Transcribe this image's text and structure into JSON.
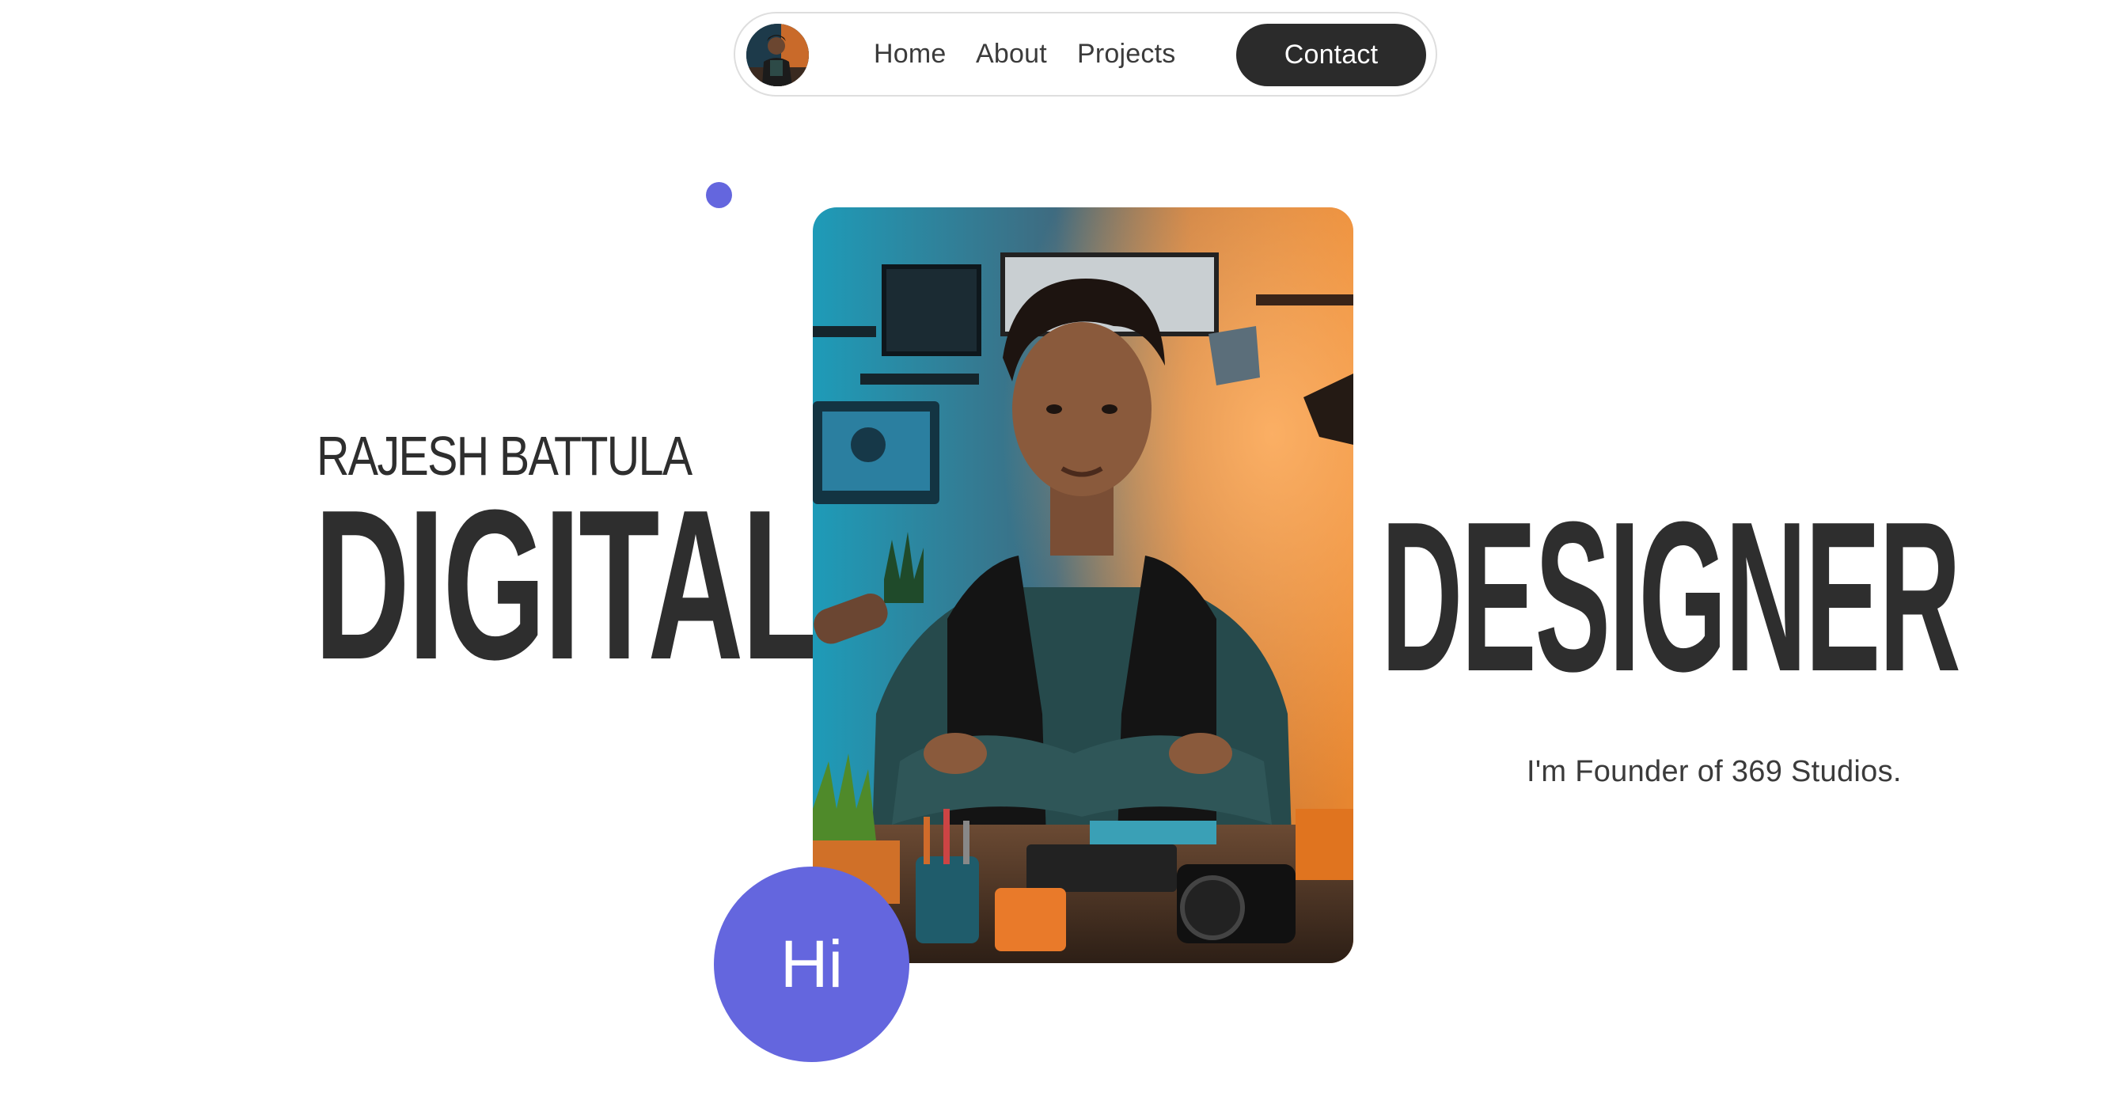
{
  "nav": {
    "avatar_alt": "profile avatar",
    "links": [
      {
        "label": "Home"
      },
      {
        "label": "About"
      },
      {
        "label": "Projects"
      }
    ],
    "contact_label": "Contact"
  },
  "hero": {
    "name": "RAJESH BATTULA",
    "word_left": "DIGITAL",
    "word_right": "DESIGNER",
    "tagline": "I'm Founder of 369 Studios.",
    "hi_label": "Hi"
  },
  "colors": {
    "accent": "#6466de",
    "dark": "#2b2b2b",
    "text": "#2e2e2e",
    "background": "#ffffff"
  }
}
